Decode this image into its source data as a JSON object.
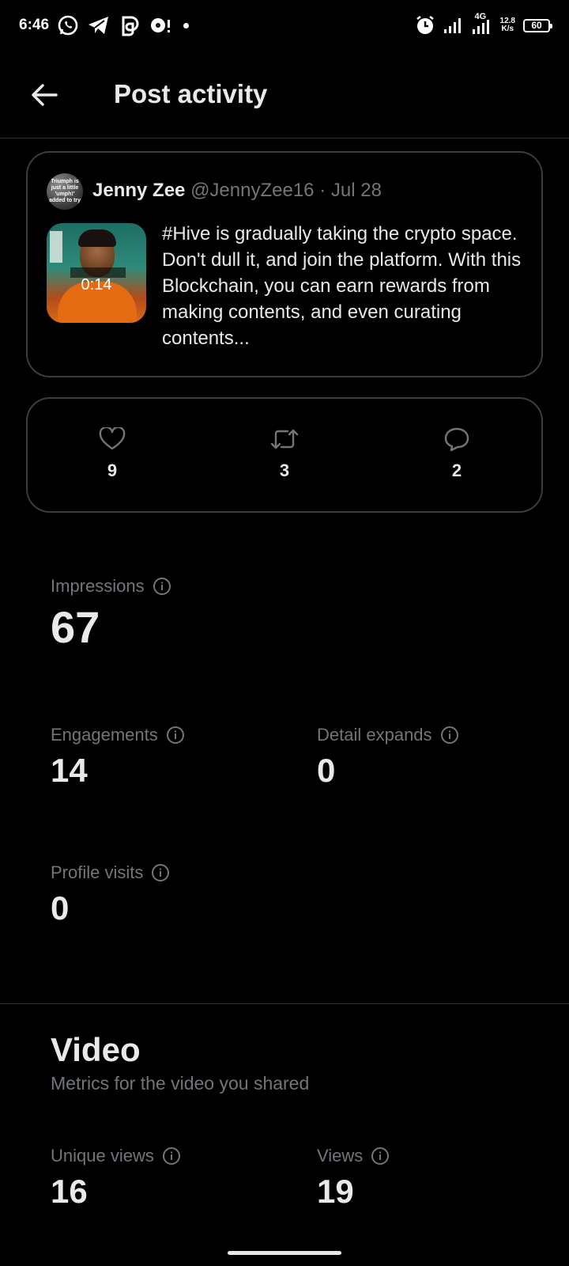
{
  "status_bar": {
    "time": "6:46",
    "network": "4G",
    "speed_value": "12.8",
    "speed_unit": "K/s",
    "battery": "60",
    "icons": [
      "whatsapp-icon",
      "telegram-icon",
      "threads-icon",
      "notification-icon",
      "alarm-icon",
      "signal-icon"
    ]
  },
  "header": {
    "title": "Post activity"
  },
  "post": {
    "avatar_text": "Triumph is just a little 'umph!' added to try",
    "author_name": "Jenny Zee",
    "author_handle": "@JennyZee16",
    "separator": "·",
    "date": "Jul 28",
    "video_duration": "0:14",
    "text": "#Hive is gradually taking the crypto space. Don't dull it, and join the platform. With this Blockchain, you can earn rewards from making contents, and even curating contents..."
  },
  "interactions": {
    "likes": "9",
    "reposts": "3",
    "replies": "2"
  },
  "metrics": {
    "impressions": {
      "label": "Impressions",
      "value": "67"
    },
    "engagements": {
      "label": "Engagements",
      "value": "14"
    },
    "detail_expands": {
      "label": "Detail expands",
      "value": "0"
    },
    "profile_visits": {
      "label": "Profile visits",
      "value": "0"
    }
  },
  "video": {
    "title": "Video",
    "subtitle": "Metrics for the video you shared",
    "unique_views": {
      "label": "Unique views",
      "value": "16"
    },
    "views": {
      "label": "Views",
      "value": "19"
    }
  },
  "colors": {
    "background": "#000000",
    "primary_text": "#e7e9ea",
    "secondary_text": "#71767b",
    "border": "#3a3d40"
  }
}
